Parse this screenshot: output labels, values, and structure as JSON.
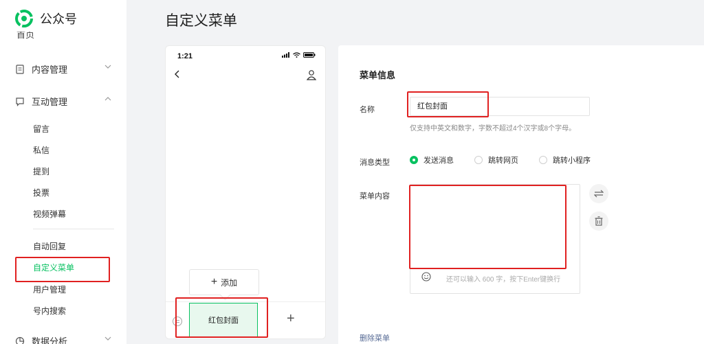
{
  "app": {
    "name": "公众号"
  },
  "sidebar": {
    "partial_item": "首页",
    "sections": [
      {
        "label": "内容管理"
      },
      {
        "label": "互动管理"
      },
      {
        "label": "数据分析"
      }
    ],
    "sub_items": [
      {
        "label": "留言"
      },
      {
        "label": "私信"
      },
      {
        "label": "提到"
      },
      {
        "label": "投票"
      },
      {
        "label": "视频弹幕"
      },
      {
        "label": "自动回复"
      },
      {
        "label": "自定义菜单"
      },
      {
        "label": "用户管理"
      },
      {
        "label": "号内搜索"
      }
    ]
  },
  "header": {
    "title": "自定义菜单"
  },
  "phone": {
    "time": "1:21",
    "add_label": "添加",
    "menu_item": "红包封面"
  },
  "editor": {
    "section_title": "菜单信息",
    "name_label": "名称",
    "name_value": "红包封面",
    "name_hint": "仅支持中英文和数字，字数不超过4个汉字或8个字母。",
    "msg_type_label": "消息类型",
    "msg_type_options": [
      {
        "label": "发送消息",
        "checked": true
      },
      {
        "label": "跳转网页",
        "checked": false
      },
      {
        "label": "跳转小程序",
        "checked": false
      }
    ],
    "content_label": "菜单内容",
    "remaining_text": "还可以输入 600 字，按下Enter键换行",
    "delete_label": "删除菜单"
  },
  "colors": {
    "accent": "#07c160",
    "highlight": "#e02020",
    "link": "#576b95"
  }
}
